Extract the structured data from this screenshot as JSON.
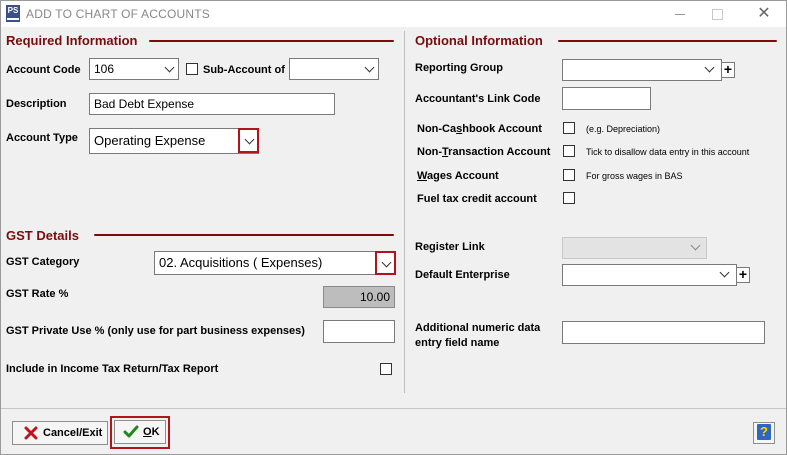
{
  "window": {
    "title": "ADD TO CHART OF ACCOUNTS",
    "app_icon": "PS"
  },
  "required": {
    "heading": "Required Information",
    "account_code_label": "Account Code",
    "account_code_value": "106",
    "sub_account_label": "Sub-Account of",
    "sub_account_value": "",
    "description_label": "Description",
    "description_value": "Bad Debt Expense",
    "account_type_label": "Account Type",
    "account_type_value": "Operating Expense"
  },
  "gst": {
    "heading": "GST Details",
    "category_label": "GST Category",
    "category_value": "02. Acquisitions ( Expenses)",
    "rate_label": "GST Rate %",
    "rate_value": "10.00",
    "private_use_label": "GST Private Use % (only use for part business expenses)",
    "private_use_value": "",
    "income_tax_label": "Include in Income Tax Return/Tax Report"
  },
  "optional": {
    "heading": "Optional Information",
    "reporting_group_label": "Reporting Group",
    "accountant_link_label": "Accountant's Link Code",
    "non_cashbook_pre": "Non-Ca",
    "non_cashbook_u": "s",
    "non_cashbook_post": "hbook Account",
    "non_cashbook_hint": "(e.g. Depreciation)",
    "non_transaction_pre": "Non-",
    "non_transaction_u": "T",
    "non_transaction_post": "ransaction Account",
    "non_transaction_hint": "Tick to disallow data entry in this account",
    "wages_u": "W",
    "wages_post": "ages Account",
    "wages_hint": "For gross wages in BAS",
    "fuel_tax_label": "Fuel tax credit account",
    "register_link_label": "Register Link",
    "default_enterprise_label": "Default Enterprise",
    "additional_label_1": "Additional numeric data",
    "additional_label_2": "entry field name"
  },
  "buttons": {
    "cancel": "Cancel/Exit",
    "ok_u": "O",
    "ok_post": "K",
    "help": "?"
  },
  "colors": {
    "accent": "#7a0c0c",
    "highlight": "#b0141c"
  }
}
